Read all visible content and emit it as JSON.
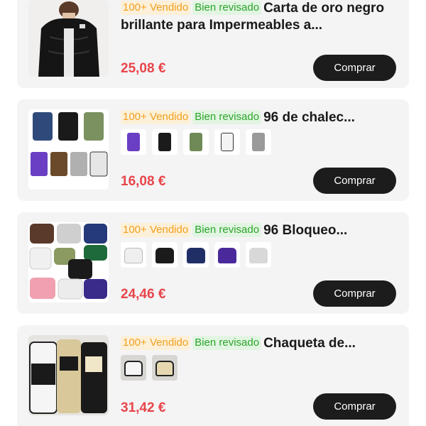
{
  "products": [
    {
      "sold_tag": "100+ Vendido",
      "review_tag": "Bien revisado",
      "title": "Carta de oro negro brillante para Impermeables a...",
      "price": "25,08 €",
      "buy_label": "Comprar"
    },
    {
      "sold_tag": "100+ Vendido",
      "review_tag": "Bien revisado",
      "title": "96 de chalec...",
      "price": "16,08 €",
      "buy_label": "Comprar",
      "variant_colors": [
        "#6a3fc4",
        "#1b1b1b",
        "#6f8a57",
        "#f3f3f3",
        "#9a9a9a"
      ]
    },
    {
      "sold_tag": "100+ Vendido",
      "review_tag": "Bien revisado",
      "title": "96 Bloqueo...",
      "price": "24,46 €",
      "buy_label": "Comprar",
      "variant_colors": [
        "#efefef",
        "#1b1b1b",
        "#1f2f66",
        "#4a2a9a",
        "#d8d8d8"
      ]
    },
    {
      "sold_tag": "100+ Vendido",
      "review_tag": "Bien revisado",
      "title": "Chaqueta de...",
      "price": "31,42 €",
      "buy_label": "Comprar",
      "variant_colors": [
        "#f5f5f5",
        "#e5d8b0"
      ]
    }
  ],
  "colors": {
    "card_bg": "#f4f4f5",
    "price": "#e8454a",
    "button_bg": "#1c1c1c",
    "sold_tag": "#f0a020",
    "review_tag": "#2aa52a"
  }
}
